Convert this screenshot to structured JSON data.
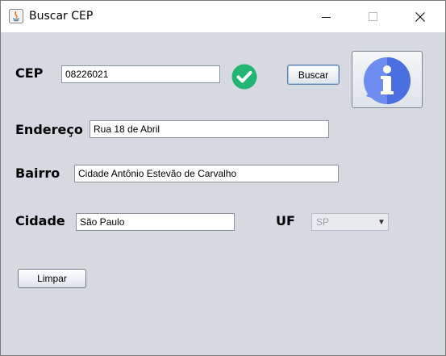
{
  "window": {
    "title": "Buscar CEP"
  },
  "form": {
    "cep_label": "CEP",
    "cep_value": "08226021",
    "search_button": "Buscar",
    "endereco_label": "Endereço",
    "endereco_value": "Rua 18 de Abril",
    "bairro_label": "Bairro",
    "bairro_value": "Cidade Antônio Estevão de Carvalho",
    "cidade_label": "Cidade",
    "cidade_value": "São Paulo",
    "uf_label": "UF",
    "uf_value": "SP",
    "clear_button": "Limpar"
  },
  "icons": {
    "app": "java-icon",
    "valid": "check-circle-icon",
    "info": "info-icon"
  },
  "colors": {
    "valid_green": "#22b573",
    "info_blue": "#4a6fe0"
  }
}
